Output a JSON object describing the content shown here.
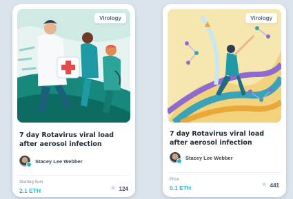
{
  "cards": [
    {
      "tag": "Virology",
      "title": "7 day Rotavirus viral load after aerosol infection",
      "author": "Stacey Lee Webber",
      "price_label": "Starting from",
      "price_value": "2.1 ETH",
      "likes": "124",
      "art_icon": "medics-running-illustration"
    },
    {
      "tag": "Virology",
      "title": "7 day Rotavirus viral load after aerosol infection",
      "author": "Stacey Lee Webber",
      "price_label": "Price",
      "price_value": "0.1 ETH",
      "likes": "441",
      "art_icon": "molecule-figure-illustration"
    }
  ],
  "colors": {
    "accent": "#29b6c9",
    "card_background": "#ffffff",
    "page_background": "#dbe4ec"
  }
}
